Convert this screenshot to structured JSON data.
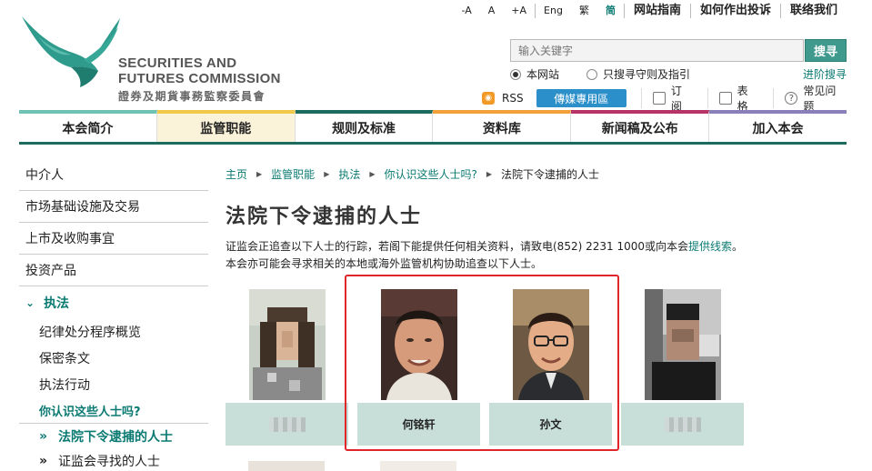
{
  "util_bar": {
    "font_small": "-A",
    "font_mid": "A",
    "font_large": "+A",
    "lang_en": "Eng",
    "lang_tc": "繁",
    "lang_sc": "简",
    "site_guide": "网站指南",
    "how_to_complain": "如何作出投诉",
    "contact_us": "联络我们"
  },
  "logo": {
    "en_line1": "SECURITIES AND",
    "en_line2": "FUTURES COMMISSION",
    "zh": "證券及期貨事務監察委員會"
  },
  "search": {
    "placeholder": "输入关键字",
    "button": "搜寻",
    "option_site": "本网站",
    "option_guides": "只搜寻守则及指引",
    "advanced": "进阶搜寻"
  },
  "toolbar": {
    "rss": "RSS",
    "media": "傳媒專用區",
    "subscribe": "订阅",
    "forms": "表格",
    "faq": "常见问题"
  },
  "nav": [
    {
      "label": "本会简介",
      "accent": "#6fc3b3"
    },
    {
      "label": "监管职能",
      "accent": "#f0c94a"
    },
    {
      "label": "规则及标准",
      "accent": "#1d6b5f"
    },
    {
      "label": "资料库",
      "accent": "#f2a13a"
    },
    {
      "label": "新闻稿及公布",
      "accent": "#b8336a"
    },
    {
      "label": "加入本会",
      "accent": "#8a7fb8"
    }
  ],
  "sidebar": {
    "intermediaries": "中介人",
    "market_infra": "市场基础设施及交易",
    "listing": "上市及收购事宜",
    "products": "投资产品",
    "enforcement": "执法",
    "disciplinary": "纪律处分程序概览",
    "secrecy": "保密条文",
    "actions": "执法行动",
    "do_you_know": "你认识这些人士吗?",
    "warrants": "法院下令逮捕的人士",
    "sought": "证监会寻找的人士"
  },
  "breadcrumb": {
    "home": "主页",
    "functions": "监管职能",
    "enforcement": "执法",
    "do_you_know": "你认识这些人士吗?",
    "current": "法院下令逮捕的人士"
  },
  "page": {
    "title": "法院下令逮捕的人士",
    "intro_before_link": "证监会正追查以下人士的行踪，若阁下能提供任何相关资料，请致电(852) 2231 1000或向本会",
    "intro_link": "提供线索",
    "intro_after_link": "。本会亦可能会寻求相关的本地或海外监管机构协助追查以下人士。"
  },
  "persons": [
    {
      "name": ""
    },
    {
      "name": "何铭轩"
    },
    {
      "name": "孙文"
    },
    {
      "name": ""
    }
  ]
}
